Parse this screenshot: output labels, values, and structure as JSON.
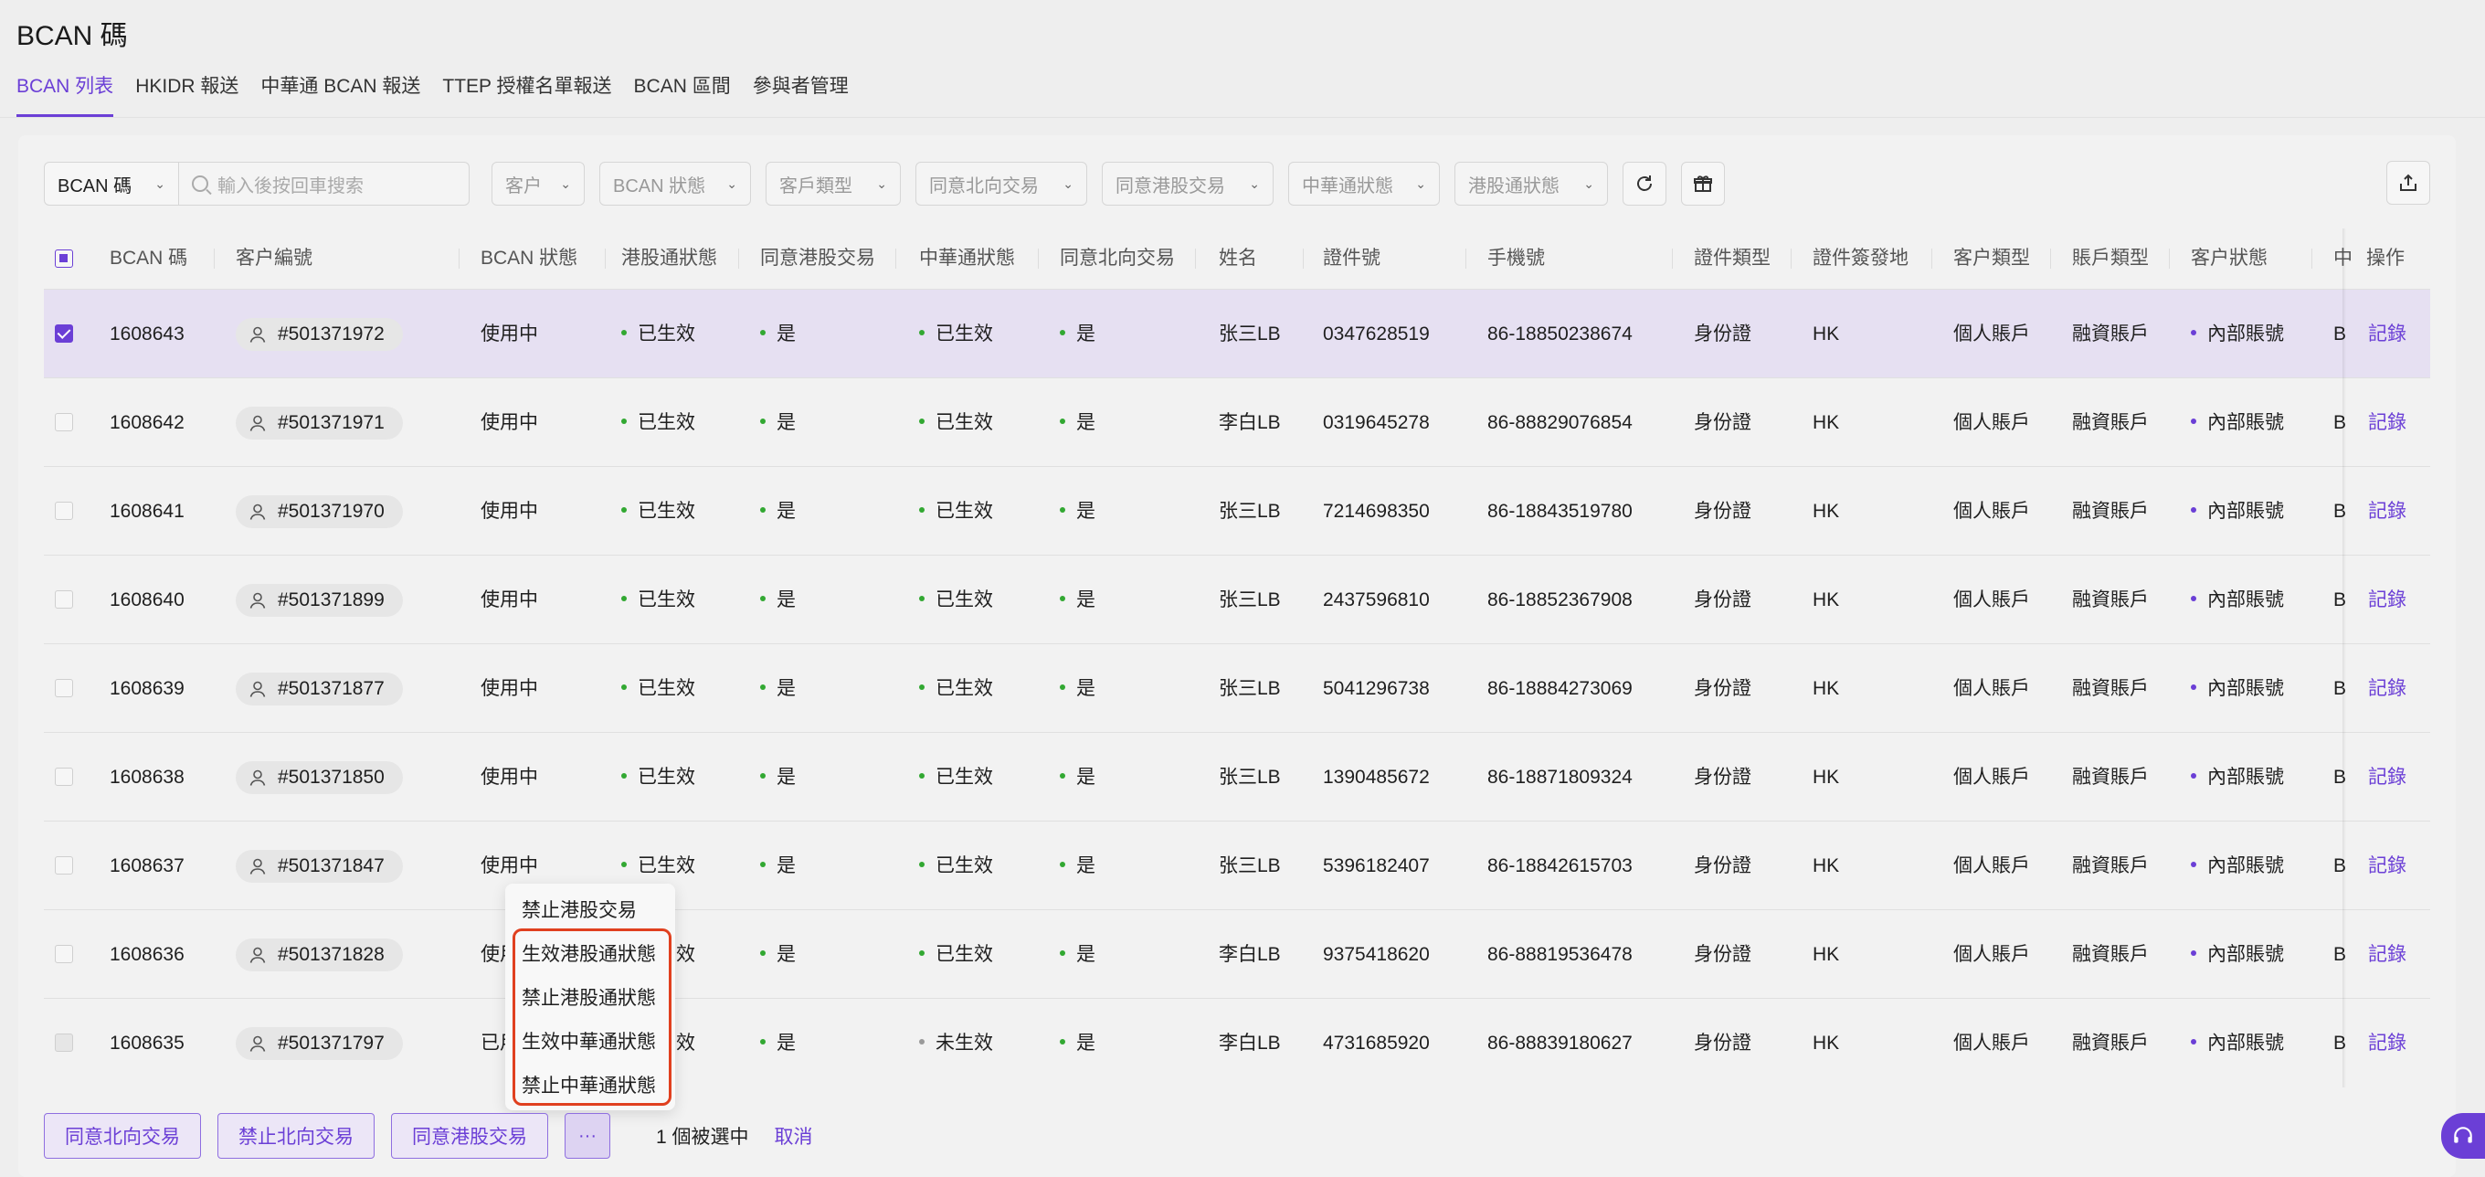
{
  "page": {
    "title": "BCAN 碼"
  },
  "tabs": [
    {
      "label": "BCAN 列表",
      "active": true
    },
    {
      "label": "HKIDR 報送"
    },
    {
      "label": "中華通 BCAN 報送"
    },
    {
      "label": "TTEP 授權名單報送"
    },
    {
      "label": "BCAN 區間"
    },
    {
      "label": "參與者管理"
    }
  ],
  "filters": {
    "main_select": "BCAN 碼",
    "search_placeholder": "輸入後按回車搜索",
    "dropdowns": [
      "客户",
      "BCAN 狀態",
      "客戶類型",
      "同意北向交易",
      "同意港股交易",
      "中華通狀態",
      "港股通狀態"
    ],
    "refresh_icon": "refresh-icon",
    "gift_icon": "gift-icon",
    "export_icon": "export-icon"
  },
  "table": {
    "columns": [
      "BCAN 碼",
      "客户編號",
      "BCAN 狀態",
      "港股通狀態",
      "同意港股交易",
      "中華通狀態",
      "同意北向交易",
      "姓名",
      "證件號",
      "手機號",
      "證件類型",
      "證件簽發地",
      "客户類型",
      "賬戶類型",
      "客户狀態",
      "中",
      "操作"
    ],
    "rows": [
      {
        "bcan": "1608643",
        "client": "#501371972",
        "status": "使用中",
        "hk": "已生效",
        "agree_hk": "是",
        "cn": "已生效",
        "agree_nb": "是",
        "name": "张三LB",
        "id_no": "0347628519",
        "phone": "86-18850238674",
        "id_type": "身份證",
        "issuer": "HK",
        "cust_type": "個人賬戶",
        "acct_type": "融資賬戶",
        "cust_status": "內部賬號",
        "trunc": "B",
        "action": "記錄"
      },
      {
        "bcan": "1608642",
        "client": "#501371971",
        "status": "使用中",
        "hk": "已生效",
        "agree_hk": "是",
        "cn": "已生效",
        "agree_nb": "是",
        "name": "李白LB",
        "id_no": "0319645278",
        "phone": "86-88829076854",
        "id_type": "身份證",
        "issuer": "HK",
        "cust_type": "個人賬戶",
        "acct_type": "融資賬戶",
        "cust_status": "內部賬號",
        "trunc": "B",
        "action": "記錄"
      },
      {
        "bcan": "1608641",
        "client": "#501371970",
        "status": "使用中",
        "hk": "已生效",
        "agree_hk": "是",
        "cn": "已生效",
        "agree_nb": "是",
        "name": "张三LB",
        "id_no": "7214698350",
        "phone": "86-18843519780",
        "id_type": "身份證",
        "issuer": "HK",
        "cust_type": "個人賬戶",
        "acct_type": "融資賬戶",
        "cust_status": "內部賬號",
        "trunc": "B",
        "action": "記錄"
      },
      {
        "bcan": "1608640",
        "client": "#501371899",
        "status": "使用中",
        "hk": "已生效",
        "agree_hk": "是",
        "cn": "已生效",
        "agree_nb": "是",
        "name": "张三LB",
        "id_no": "2437596810",
        "phone": "86-18852367908",
        "id_type": "身份證",
        "issuer": "HK",
        "cust_type": "個人賬戶",
        "acct_type": "融資賬戶",
        "cust_status": "內部賬號",
        "trunc": "B",
        "action": "記錄"
      },
      {
        "bcan": "1608639",
        "client": "#501371877",
        "status": "使用中",
        "hk": "已生效",
        "agree_hk": "是",
        "cn": "已生效",
        "agree_nb": "是",
        "name": "张三LB",
        "id_no": "5041296738",
        "phone": "86-18884273069",
        "id_type": "身份證",
        "issuer": "HK",
        "cust_type": "個人賬戶",
        "acct_type": "融資賬戶",
        "cust_status": "內部賬號",
        "trunc": "B",
        "action": "記錄"
      },
      {
        "bcan": "1608638",
        "client": "#501371850",
        "status": "使用中",
        "hk": "已生效",
        "agree_hk": "是",
        "cn": "已生效",
        "agree_nb": "是",
        "name": "张三LB",
        "id_no": "1390485672",
        "phone": "86-18871809324",
        "id_type": "身份證",
        "issuer": "HK",
        "cust_type": "個人賬戶",
        "acct_type": "融資賬戶",
        "cust_status": "內部賬號",
        "trunc": "B",
        "action": "記錄"
      },
      {
        "bcan": "1608637",
        "client": "#501371847",
        "status": "使用中",
        "hk": "已生效",
        "agree_hk": "是",
        "cn": "已生效",
        "agree_nb": "是",
        "name": "张三LB",
        "id_no": "5396182407",
        "phone": "86-18842615703",
        "id_type": "身份證",
        "issuer": "HK",
        "cust_type": "個人賬戶",
        "acct_type": "融資賬戶",
        "cust_status": "內部賬號",
        "trunc": "B",
        "action": "記錄"
      },
      {
        "bcan": "1608636",
        "client": "#501371828",
        "status": "使用中",
        "hk": "已生效",
        "agree_hk": "是",
        "cn": "已生效",
        "agree_nb": "是",
        "name": "李白LB",
        "id_no": "9375418620",
        "phone": "86-88819536478",
        "id_type": "身份證",
        "issuer": "HK",
        "cust_type": "個人賬戶",
        "acct_type": "融資賬戶",
        "cust_status": "內部賬號",
        "trunc": "B",
        "action": "記錄"
      },
      {
        "bcan": "1608635",
        "client": "#501371797",
        "status": "已用",
        "hk": "已生效",
        "agree_hk": "是",
        "cn": "未生效",
        "agree_nb": "是",
        "name": "李白LB",
        "id_no": "4731685920",
        "phone": "86-88839180627",
        "id_type": "身份證",
        "issuer": "HK",
        "cust_type": "個人賬戶",
        "acct_type": "融資賬戶",
        "cust_status": "內部賬號",
        "trunc": "B",
        "action": "記錄"
      }
    ]
  },
  "more_menu": {
    "items": [
      "禁止港股交易",
      "生效港股通狀態",
      "禁止港股通狀態",
      "生效中華通狀態",
      "禁止中華通狀態"
    ]
  },
  "bulk_actions": {
    "buttons": [
      "同意北向交易",
      "禁止北向交易",
      "同意港股交易"
    ],
    "more": "···",
    "selected_text": "1 個被選中",
    "cancel": "取消"
  },
  "colors": {
    "accent": "#6b3fd6",
    "success": "#32a832",
    "inactive": "#9a9a9a",
    "highlight": "#e0401f"
  }
}
